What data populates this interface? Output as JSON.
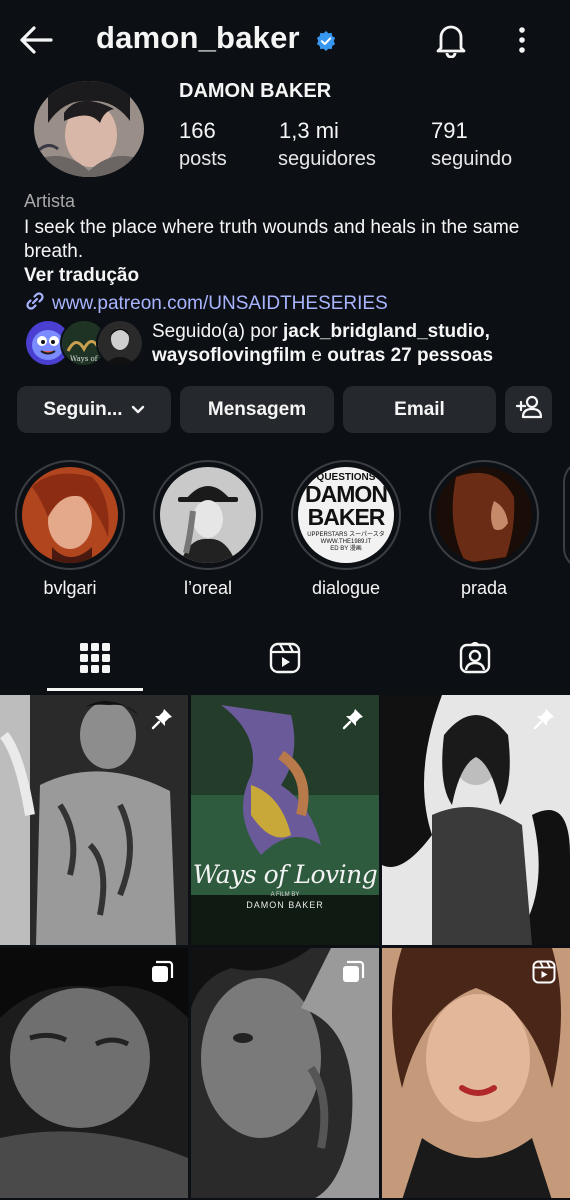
{
  "header": {
    "username": "damon_baker",
    "icons": {
      "back": "back-arrow-icon",
      "verified": "verified-badge-icon",
      "notifications": "bell-icon",
      "more": "more-vertical-icon"
    }
  },
  "profile": {
    "full_name": "DAMON BAKER",
    "stats": {
      "posts": {
        "value": "166",
        "label": "posts"
      },
      "followers": {
        "value": "1,3 mi",
        "label": "seguidores"
      },
      "following": {
        "value": "791",
        "label": "seguindo"
      }
    },
    "category": "Artista",
    "bio": "I seek the place where truth wounds and heals in the same breath.",
    "translate_label": "Ver tradução",
    "link": "www.patreon.com/UNSAIDTHESERIES",
    "followed_by": {
      "prefix": "Seguido(a) por ",
      "account1": "jack_bridgland_studio,",
      "account2": "waysoflovingfilm",
      "middle": " e ",
      "others": "outras 27 pessoas"
    }
  },
  "actions": {
    "following": "Seguin...",
    "message": "Mensagem",
    "email": "Email"
  },
  "highlights": [
    {
      "label": "bvlgari"
    },
    {
      "label": "l’oreal"
    },
    {
      "label": "dialogue",
      "cover_text": [
        "QUESTIONS",
        "DAMON",
        "BAKER",
        "UPPERSTARS スーパースタ",
        "WWW.THE1989.IT",
        "ED BY 漫画"
      ]
    },
    {
      "label": "prada"
    }
  ],
  "poster": {
    "title": "Ways of Loving",
    "byline": "A FILM BY",
    "director": "DAMON BAKER"
  },
  "colors": {
    "background": "#0c1014",
    "button": "#25292e",
    "link": "#a8b4ff",
    "verified": "#3897f0",
    "muted": "#a8a8a8"
  }
}
